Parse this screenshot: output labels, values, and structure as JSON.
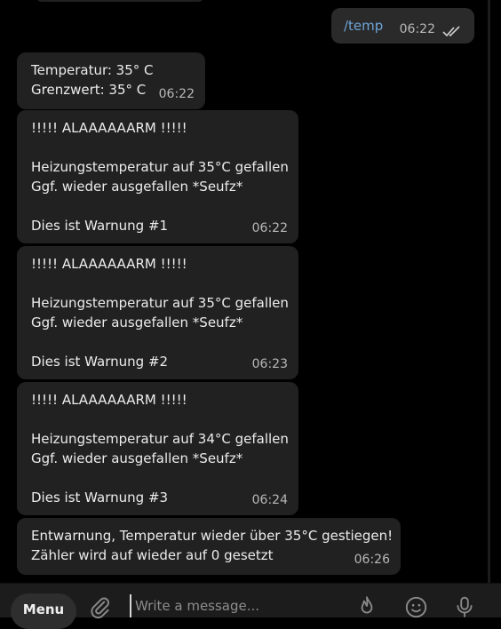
{
  "outgoing": {
    "text": "/temp",
    "time": "06:22"
  },
  "messages": [
    {
      "lines": [
        "Temperatur: 35° C",
        "Grenzwert: 35° C"
      ],
      "time": "06:22"
    },
    {
      "lines": [
        "!!!!! ALAAAAAARM !!!!!",
        "",
        "Heizungstemperatur auf 35°C gefallen",
        "Ggf. wieder ausgefallen *Seufz*",
        "",
        "Dies ist Warnung #1"
      ],
      "time": "06:22"
    },
    {
      "lines": [
        "!!!!! ALAAAAAARM !!!!!",
        "",
        "Heizungstemperatur auf 35°C gefallen",
        "Ggf. wieder ausgefallen *Seufz*",
        "",
        "Dies ist Warnung #2"
      ],
      "time": "06:23"
    },
    {
      "lines": [
        "!!!!! ALAAAAAARM !!!!!",
        "",
        "Heizungstemperatur auf 34°C gefallen",
        "Ggf. wieder ausgefallen *Seufz*",
        "",
        "Dies ist Warnung #3"
      ],
      "time": "06:24"
    },
    {
      "lines": [
        "Entwarnung, Temperatur wieder über 35°C gestiegen!",
        "Zähler wird auf wieder auf 0 gesetzt"
      ],
      "time": "06:26"
    }
  ],
  "composer": {
    "menu_label": "Menu",
    "placeholder": "Write a message..."
  },
  "icons": {
    "attach": "paperclip-icon",
    "fire": "fire-icon",
    "emoji": "emoji-icon",
    "mic": "microphone-icon",
    "ticks": "double-check-icon"
  }
}
